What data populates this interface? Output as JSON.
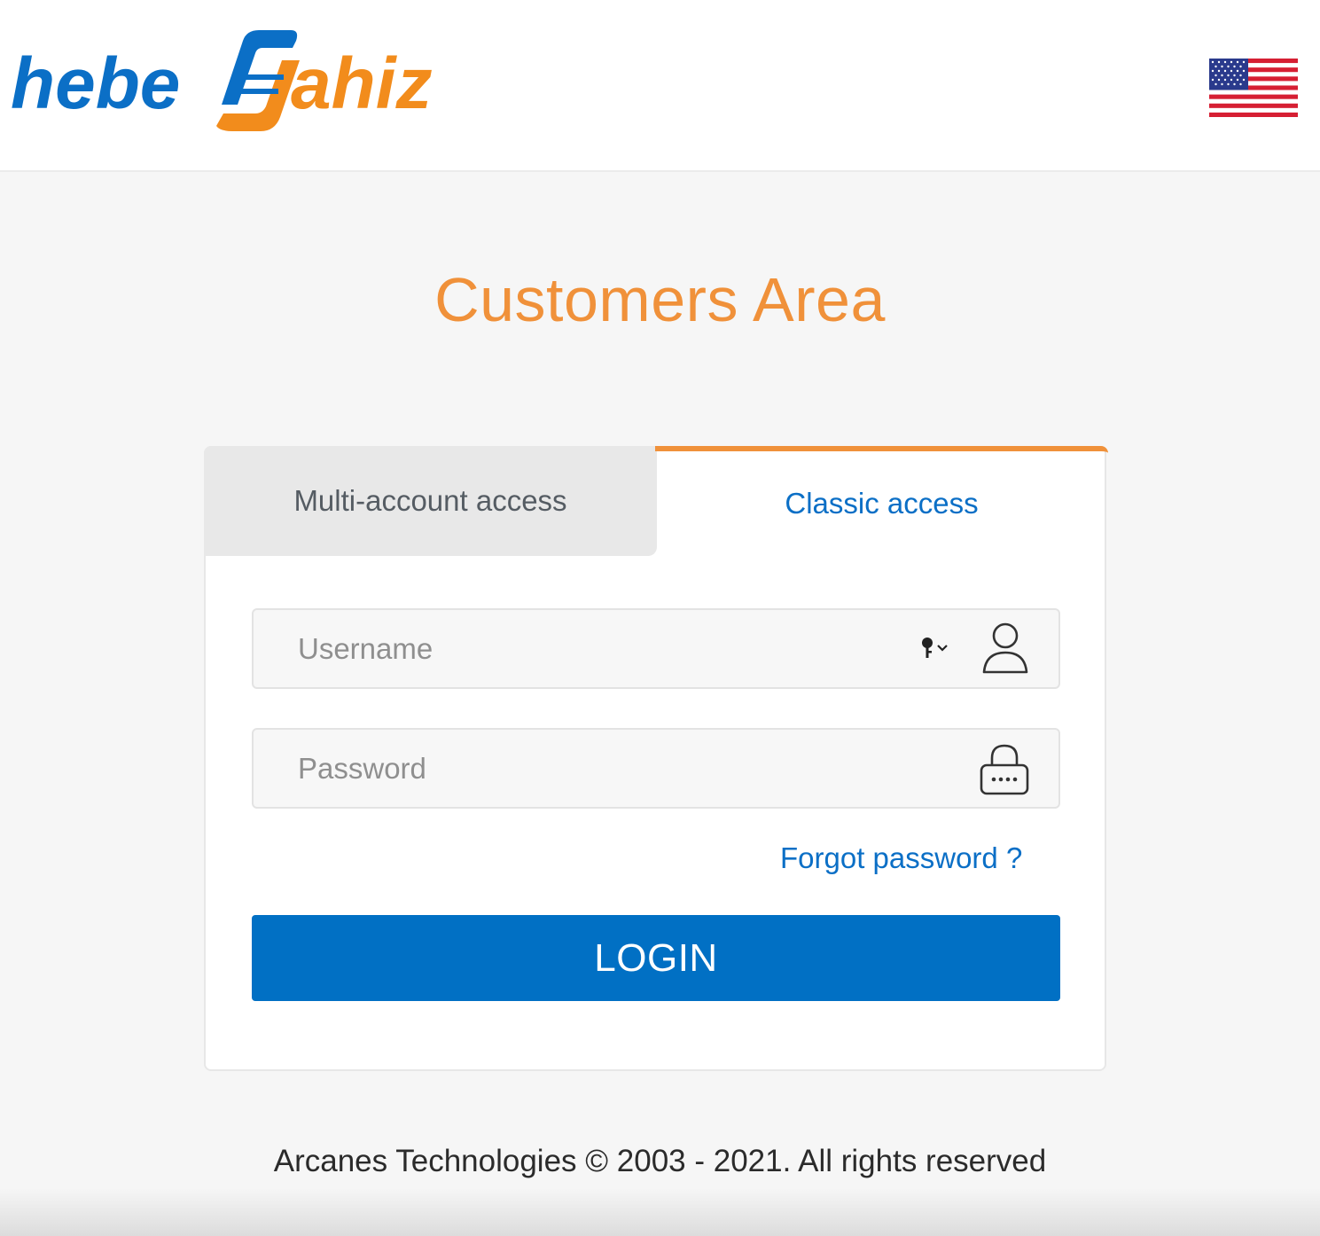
{
  "header": {
    "logo": {
      "text_part1": "hebe",
      "text_part2": "ahiz",
      "brand_blue": "#0b6fc6",
      "brand_orange": "#f28c1c"
    },
    "language_flag_icon": "us-flag-icon"
  },
  "page": {
    "title": "Customers Area",
    "title_color": "#f0913a"
  },
  "login_card": {
    "tabs": [
      {
        "label": "Multi-account access",
        "active": false
      },
      {
        "label": "Classic access",
        "active": true
      }
    ],
    "username": {
      "placeholder": "Username",
      "value": "",
      "icon": "user-icon",
      "autofill_icon": "key-icon"
    },
    "password": {
      "placeholder": "Password",
      "value": "",
      "icon": "lock-icon"
    },
    "forgot_link": "Forgot password ?",
    "login_button": "LOGIN",
    "accent_color": "#0170c4"
  },
  "footer": {
    "copyright": "Arcanes Technologies © 2003 - 2021. All rights reserved"
  }
}
